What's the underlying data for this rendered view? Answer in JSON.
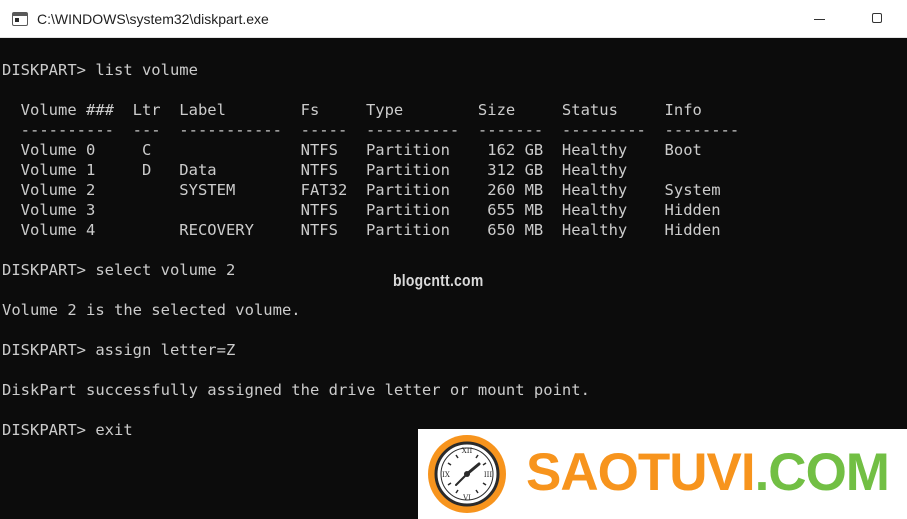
{
  "window": {
    "title": "C:\\WINDOWS\\system32\\diskpart.exe",
    "icon": "console-app-icon",
    "controls": [
      "minimize-icon",
      "maximize-icon"
    ]
  },
  "console": {
    "lines": [
      "DISKPART> list volume",
      "",
      "  Volume ###  Ltr  Label        Fs     Type        Size     Status     Info",
      "  ----------  ---  -----------  -----  ----------  -------  ---------  --------",
      "  Volume 0     C                NTFS   Partition    162 GB  Healthy    Boot",
      "  Volume 1     D   Data         NTFS   Partition    312 GB  Healthy",
      "  Volume 2         SYSTEM       FAT32  Partition    260 MB  Healthy    System",
      "  Volume 3                      NTFS   Partition    655 MB  Healthy    Hidden",
      "  Volume 4         RECOVERY     NTFS   Partition    650 MB  Healthy    Hidden",
      "",
      "DISKPART> select volume 2",
      "",
      "Volume 2 is the selected volume.",
      "",
      "DISKPART> assign letter=Z",
      "",
      "DiskPart successfully assigned the drive letter or mount point.",
      "",
      "DISKPART> exit"
    ]
  },
  "watermark": {
    "text": "blogcntt.com"
  },
  "brand": {
    "part1": "SAOTUVI",
    "part2": ".COM",
    "color1": "#f7941d",
    "color2": "#72bf44",
    "logo_icon": "clock-icon"
  },
  "colors": {
    "console_bg": "#0c0c0c",
    "console_text": "#cccccc",
    "titlebar_bg": "#ffffff"
  }
}
